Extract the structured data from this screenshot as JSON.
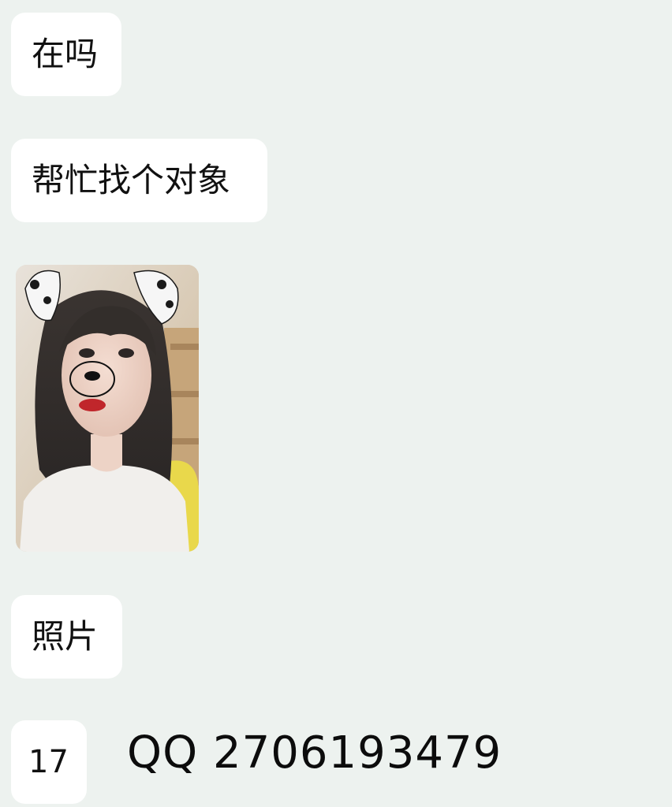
{
  "chat": {
    "messages": [
      {
        "text": "在吗"
      },
      {
        "text": "帮忙找个对象"
      },
      {
        "text": "照片"
      },
      {
        "text": "17"
      }
    ]
  },
  "overlay": {
    "qq_text": "QQ 2706193479"
  },
  "colors": {
    "background": "#edf2ef",
    "bubble": "#ffffff",
    "text": "#111111"
  }
}
